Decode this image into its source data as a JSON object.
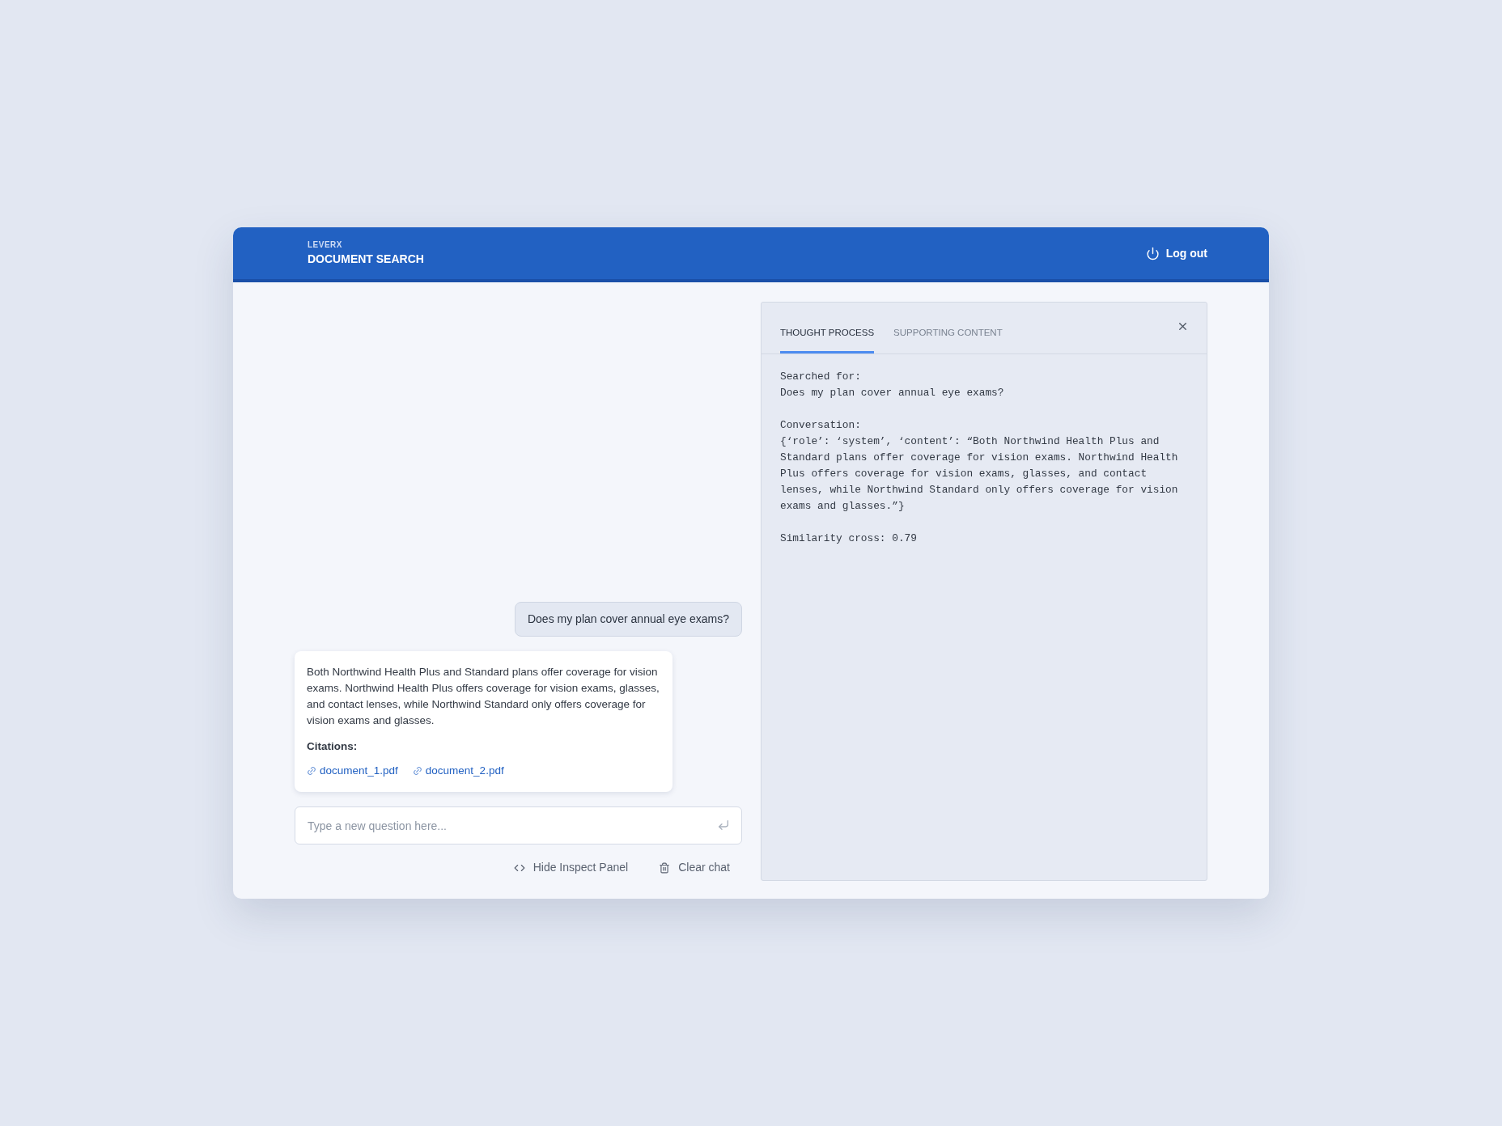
{
  "header": {
    "brand": "LEVERX",
    "title": "DOCUMENT SEARCH",
    "logout": "Log out"
  },
  "chat": {
    "messages": [
      {
        "kind": "user",
        "text": "Does my plan cover annual eye exams?"
      },
      {
        "kind": "answer",
        "text": "Both Northwind Health Plus and Standard plans offer coverage for vision exams. Northwind Health Plus offers coverage for vision exams, glasses, and contact lenses, while Northwind Standard only offers coverage for vision exams and glasses.",
        "citations_label": "Citations:",
        "citations": [
          "document_1.pdf",
          "document_2.pdf"
        ]
      }
    ],
    "input": {
      "placeholder": "Type a new question here..."
    },
    "actions": [
      {
        "kind": "code",
        "label": "Hide Inspect Panel"
      },
      {
        "kind": "trash",
        "label": "Clear chat"
      }
    ]
  },
  "inspect_panel": {
    "tabs": [
      {
        "label": "THOUGHT PROCESS",
        "selected": true
      },
      {
        "label": "SUPPORTING CONTENT",
        "selected": false
      }
    ],
    "blocks": [
      {
        "label": "Searched for:",
        "text": "Does my plan cover annual eye exams?"
      },
      {
        "label": "Conversation:",
        "text": "{‘role’: ‘system’, ‘content’: “Both Northwind Health Plus and Standard plans offer coverage for vision exams. Northwind Health Plus offers coverage for vision exams, glasses, and contact lenses, while Northwind Standard only offers coverage for vision exams and glasses.”}"
      },
      {
        "text": "Similarity cross: 0.79"
      }
    ]
  }
}
